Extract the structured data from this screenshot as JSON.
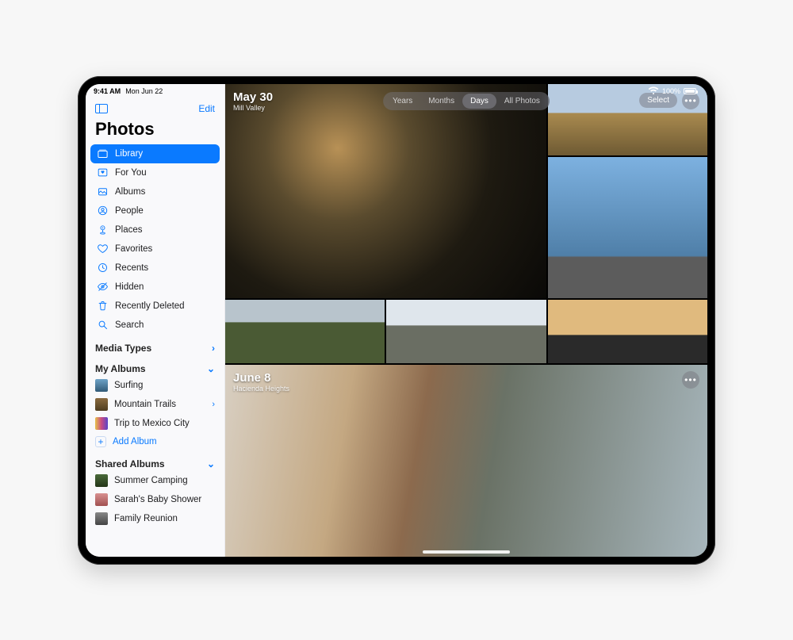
{
  "statusbar": {
    "time": "9:41 AM",
    "date": "Mon Jun 22",
    "battery_pct": "100%"
  },
  "sidebar": {
    "edit_label": "Edit",
    "title": "Photos",
    "items": [
      {
        "label": "Library"
      },
      {
        "label": "For You"
      },
      {
        "label": "Albums"
      },
      {
        "label": "People"
      },
      {
        "label": "Places"
      },
      {
        "label": "Favorites"
      },
      {
        "label": "Recents"
      },
      {
        "label": "Hidden"
      },
      {
        "label": "Recently Deleted"
      },
      {
        "label": "Search"
      }
    ],
    "media_types_label": "Media Types",
    "my_albums_label": "My Albums",
    "my_albums": [
      {
        "label": "Surfing"
      },
      {
        "label": "Mountain Trails"
      },
      {
        "label": "Trip to Mexico City"
      }
    ],
    "add_album_label": "Add Album",
    "shared_albums_label": "Shared Albums",
    "shared_albums": [
      {
        "label": "Summer Camping"
      },
      {
        "label": "Sarah's Baby Shower"
      },
      {
        "label": "Family Reunion"
      }
    ]
  },
  "segmented": {
    "years": "Years",
    "months": "Months",
    "days": "Days",
    "all": "All Photos"
  },
  "controls": {
    "select": "Select"
  },
  "groups": [
    {
      "date": "May 30",
      "location": "Mill Valley"
    },
    {
      "date": "June 8",
      "location": "Hacienda Heights"
    }
  ]
}
